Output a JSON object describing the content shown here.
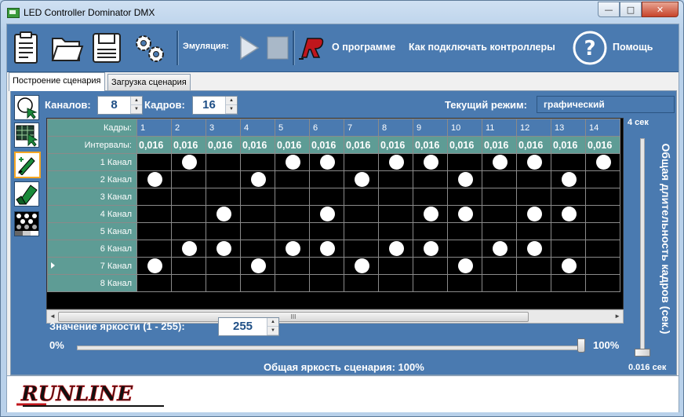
{
  "window": {
    "title": "LED Controller Dominator DMX",
    "min_glyph": "—",
    "max_glyph": "□",
    "close_glyph": "✕"
  },
  "toolbar": {
    "emulation_label": "Эмуляция:",
    "about_label": "О программе",
    "connect_label": "Как подключать контроллеры",
    "help_label": "Помощь",
    "icons": [
      "clipboard-icon",
      "open-folder-icon",
      "save-disk-icon",
      "settings-gears-icon",
      "play-icon",
      "stop-icon",
      "runline-r-logo-icon",
      "help-question-icon"
    ]
  },
  "tabs": [
    {
      "label": "Построение сценария",
      "active": true
    },
    {
      "label": "Загрузка сценария",
      "active": false
    }
  ],
  "controls": {
    "channels_label": "Каналов:",
    "channels_value": "8",
    "frames_label": "Кадров:",
    "frames_value": "16",
    "mode_label": "Текущий режим:",
    "mode_value": "графический"
  },
  "grid": {
    "frames_header": "Кадры:",
    "intervals_header": "Интервалы:",
    "frames": [
      "1",
      "2",
      "3",
      "4",
      "5",
      "6",
      "7",
      "8",
      "9",
      "10",
      "11",
      "12",
      "13",
      "14"
    ],
    "intervals": [
      "0,016",
      "0,016",
      "0,016",
      "0,016",
      "0,016",
      "0,016",
      "0,016",
      "0,016",
      "0,016",
      "0,016",
      "0,016",
      "0,016",
      "0,016",
      "0,016"
    ],
    "channels": [
      "1 Канал",
      "2 Канал",
      "3 Канал",
      "4 Канал",
      "5 Канал",
      "6 Канал",
      "7 Канал",
      "8 Канал"
    ],
    "selected_row": 6,
    "on_cells": [
      [
        0,
        1,
        0,
        0,
        1,
        1,
        0,
        1,
        1,
        0,
        1,
        1,
        0,
        1
      ],
      [
        1,
        0,
        0,
        1,
        0,
        0,
        1,
        0,
        0,
        1,
        0,
        0,
        1,
        0
      ],
      [
        0,
        0,
        0,
        0,
        0,
        0,
        0,
        0,
        0,
        0,
        0,
        0,
        0,
        0
      ],
      [
        0,
        0,
        1,
        0,
        0,
        1,
        0,
        0,
        1,
        1,
        0,
        1,
        1,
        0
      ],
      [
        0,
        0,
        0,
        0,
        0,
        0,
        0,
        0,
        0,
        0,
        0,
        0,
        0,
        0
      ],
      [
        0,
        1,
        1,
        0,
        1,
        1,
        0,
        1,
        1,
        0,
        1,
        1,
        0,
        0
      ],
      [
        1,
        0,
        0,
        1,
        0,
        0,
        1,
        0,
        0,
        1,
        0,
        0,
        1,
        0
      ],
      [
        0,
        0,
        0,
        0,
        0,
        0,
        0,
        0,
        0,
        0,
        0,
        0,
        0,
        0
      ]
    ]
  },
  "scroll": {
    "center_glyph": "III"
  },
  "brightness": {
    "label": "Значение яркости (1 - 255):",
    "value": "255",
    "min_label": "0%",
    "max_label": "100%",
    "total_label": "Общая яркость сценария: 100%",
    "level": 1.0
  },
  "duration": {
    "top_label": "4 сек",
    "bottom_label": "0.016 сек",
    "title": "Общая длительность кадров (сек.)",
    "level": 0.0
  },
  "footer": {
    "logo_text": "RUNLINE"
  },
  "colors": {
    "panel": "#4a7ab0",
    "header_teal": "#5e9c95",
    "grid_bg": "#000000",
    "dot": "#ffffff",
    "selected_border": "#f5a623"
  }
}
